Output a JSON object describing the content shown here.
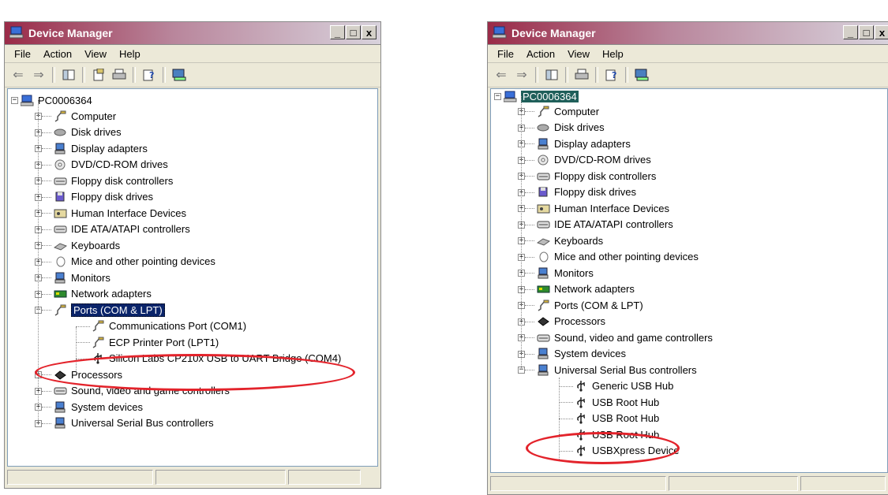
{
  "windows": [
    {
      "title": "Device Manager",
      "menu": [
        "File",
        "Action",
        "View",
        "Help"
      ],
      "root": "PC0006364",
      "categories": [
        "Computer",
        "Disk drives",
        "Display adapters",
        "DVD/CD-ROM drives",
        "Floppy disk controllers",
        "Floppy disk drives",
        "Human Interface Devices",
        "IDE ATA/ATAPI controllers",
        "Keyboards",
        "Mice and other pointing devices",
        "Monitors",
        "Network adapters",
        "Ports (COM & LPT)"
      ],
      "ports_children": [
        "Communications Port (COM1)",
        "ECP Printer Port (LPT1)",
        "Silicon Labs CP210x USB to UART Bridge (COM4)"
      ],
      "after": [
        "Processors",
        "Sound, video and game controllers",
        "System devices",
        "Universal Serial Bus controllers"
      ]
    },
    {
      "title": "Device Manager",
      "menu": [
        "File",
        "Action",
        "View",
        "Help"
      ],
      "root": "PC0006364",
      "categories": [
        "Computer",
        "Disk drives",
        "Display adapters",
        "DVD/CD-ROM drives",
        "Floppy disk controllers",
        "Floppy disk drives",
        "Human Interface Devices",
        "IDE ATA/ATAPI controllers",
        "Keyboards",
        "Mice and other pointing devices",
        "Monitors",
        "Network adapters",
        "Ports (COM & LPT)",
        "Processors",
        "Sound, video and game controllers",
        "System devices",
        "Universal Serial Bus controllers"
      ],
      "usb_children": [
        "Generic USB Hub",
        "USB Root Hub",
        "USB Root Hub",
        "USB Root Hub",
        "USBXpress Device"
      ]
    }
  ],
  "window_buttons": [
    "_",
    "□",
    "x"
  ],
  "colors": {
    "highlight_circle": "#e3232b",
    "selection": "#0a246a",
    "title_start": "#9a2b48"
  }
}
